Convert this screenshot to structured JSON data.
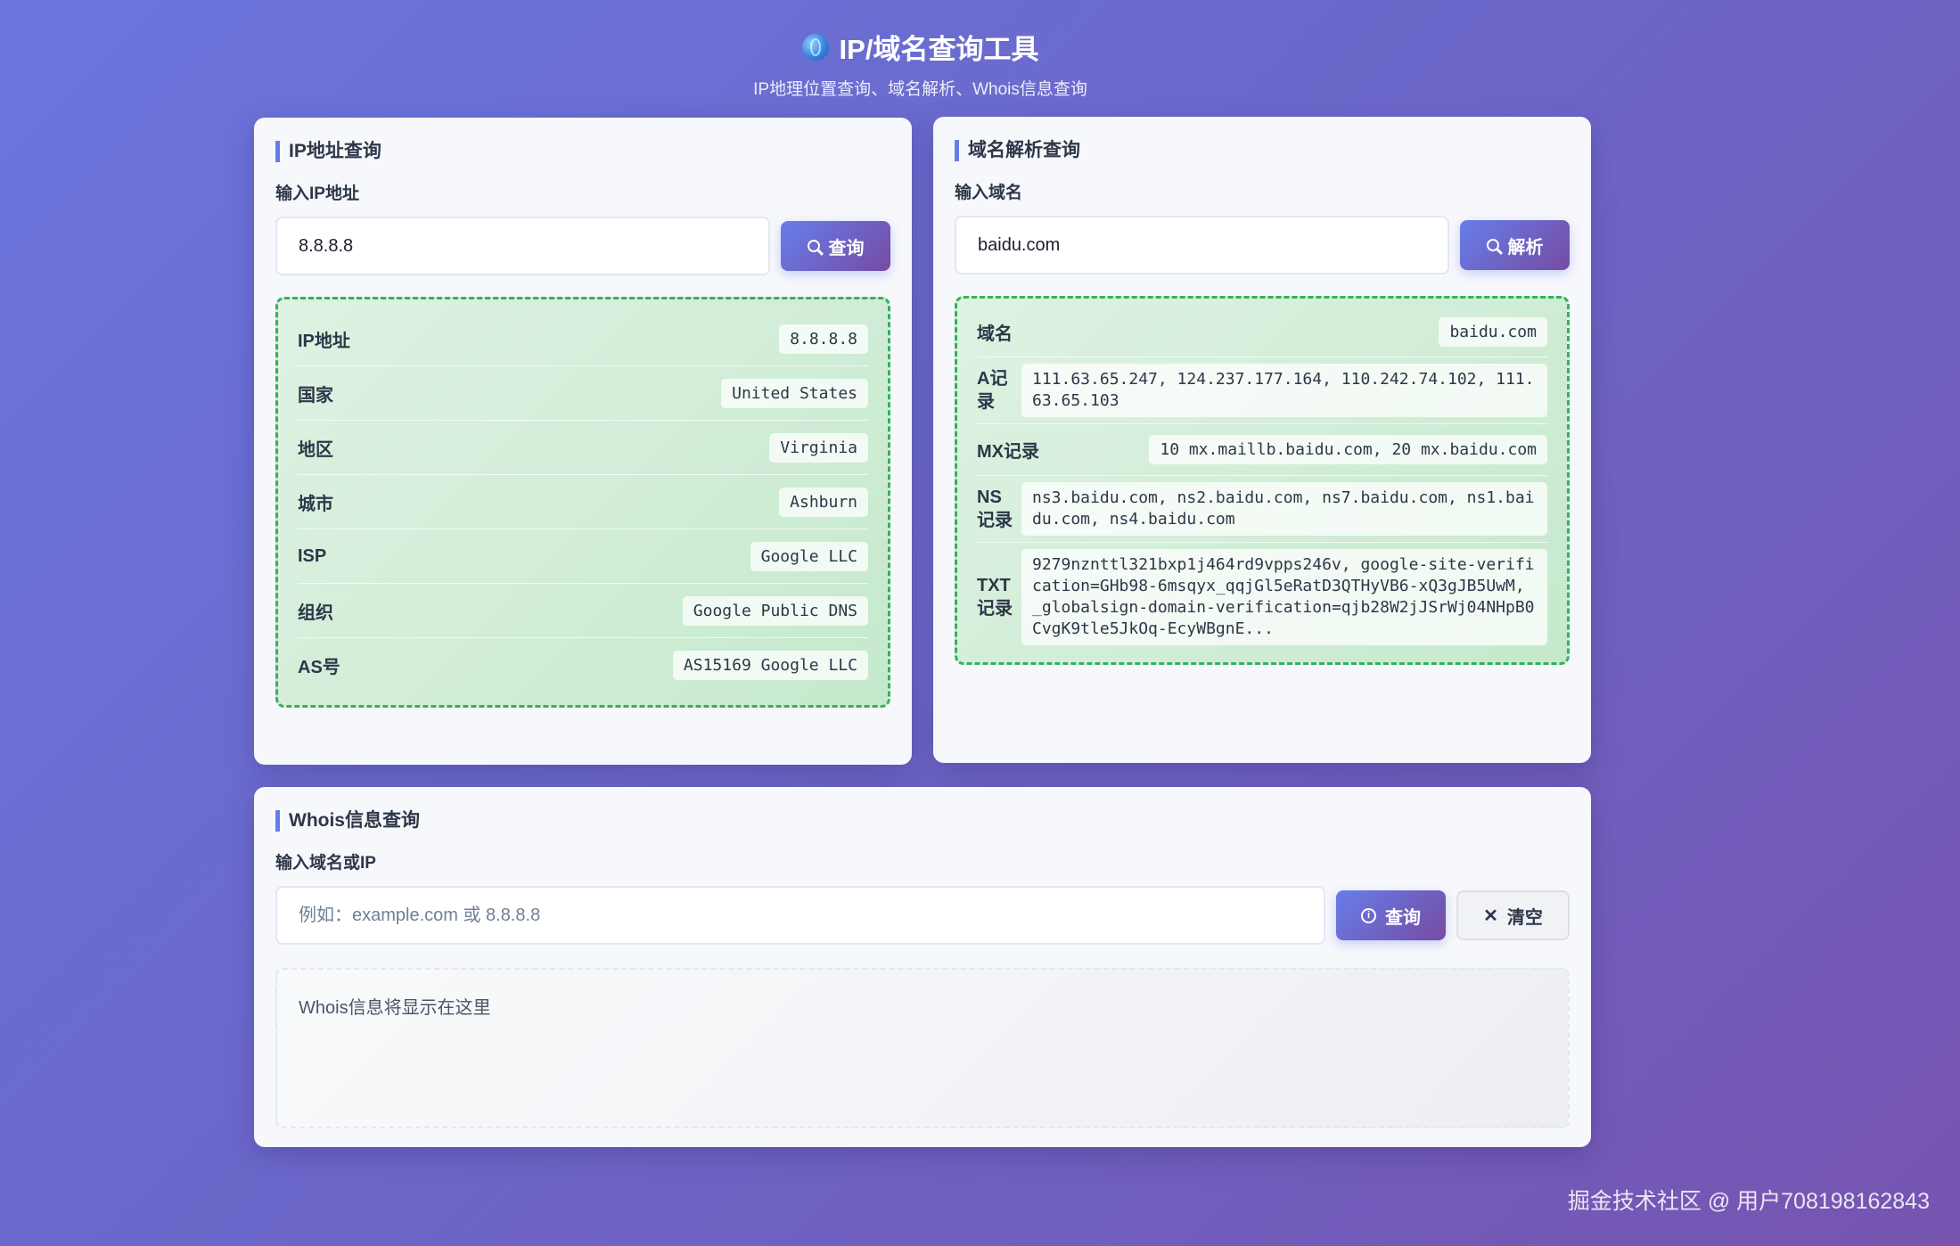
{
  "header": {
    "title": "IP/域名查询工具",
    "subtitle": "IP地理位置查询、域名解析、Whois信息查询",
    "icon": "globe-icon"
  },
  "ip_card": {
    "title": "IP地址查询",
    "input_label": "输入IP地址",
    "input_value": "8.8.8.8",
    "button_label": "查询",
    "rows": [
      {
        "label": "IP地址",
        "value": "8.8.8.8"
      },
      {
        "label": "国家",
        "value": "United States"
      },
      {
        "label": "地区",
        "value": "Virginia"
      },
      {
        "label": "城市",
        "value": "Ashburn"
      },
      {
        "label": "ISP",
        "value": "Google LLC"
      },
      {
        "label": "组织",
        "value": "Google Public DNS"
      },
      {
        "label": "AS号",
        "value": "AS15169 Google LLC"
      }
    ]
  },
  "dns_card": {
    "title": "域名解析查询",
    "input_label": "输入域名",
    "input_value": "baidu.com",
    "button_label": "解析",
    "rows": [
      {
        "label": "域名",
        "value": "baidu.com"
      },
      {
        "label": "A记录",
        "value": "111.63.65.247, 124.237.177.164, 110.242.74.102, 111.63.65.103"
      },
      {
        "label": "MX记录",
        "value": "10 mx.maillb.baidu.com, 20 mx.baidu.com"
      },
      {
        "label": "NS记录",
        "value": "ns3.baidu.com, ns2.baidu.com, ns7.baidu.com, ns1.baidu.com, ns4.baidu.com"
      },
      {
        "label": "TXT记录",
        "value": "9279nznttl321bxp1j464rd9vpps246v, google-site-verification=GHb98-6msqyx_qqjGl5eRatD3QTHyVB6-xQ3gJB5UwM, _globalsign-domain-verification=qjb28W2jJSrWj04NHpB0CvgK9tle5JkOq-EcyWBgnE..."
      }
    ]
  },
  "whois_card": {
    "title": "Whois信息查询",
    "input_label": "输入域名或IP",
    "placeholder": "例如：example.com 或 8.8.8.8",
    "query_label": "查询",
    "clear_label": "清空",
    "output_text": "Whois信息将显示在这里"
  },
  "footer": {
    "watermark": "掘金技术社区 @ 用户708198162843"
  }
}
